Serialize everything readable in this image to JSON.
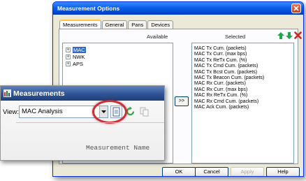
{
  "dialog": {
    "title": "Measurement Options",
    "tabs": [
      "Measurements",
      "General",
      "Pans",
      "Devices"
    ],
    "available_header": "Available",
    "selected_header": "Selected",
    "tree": [
      {
        "label": "MAC",
        "expander": "+",
        "selected": true
      },
      {
        "label": "NWK",
        "expander": "+",
        "selected": false
      },
      {
        "label": "APS",
        "expander": "+",
        "selected": false
      }
    ],
    "selected_items": [
      "MAC Tx Cum. (packets)",
      "MAC Tx Curr. (max bps)",
      "MAC Tx ReTx Cum. (%)",
      "MAC Tx Cmd Cum. (packets)",
      "MAC Tx Bcst Cum. (packets)",
      "MAC Tx Beacon Cum. (packets)",
      "MAC Rx Curr. (packets)",
      "MAC Rx Curr. (max bps)",
      "MAC Rx ReTx Cum. (%)",
      "MAC Rx Cmd Cum. (packets)",
      "MAC Ack Cum. (packets)"
    ],
    "move_button": ">>",
    "buttons": {
      "ok": "OK",
      "cancel": "Cancel",
      "apply": "Apply",
      "help": "Help"
    },
    "apply_enabled": false,
    "icons": {
      "up": "up-arrow-icon",
      "down": "down-arrow-icon",
      "delete": "red-x-delete-icon",
      "close": "close-icon"
    },
    "colors": {
      "title_bar": "#0a5fe8",
      "up_down_arrows": "#1aa84a",
      "delete": "#d8211d",
      "tree_selection": "#316ac5"
    }
  },
  "inset": {
    "title": "Measurements",
    "view_label": "View:",
    "view_value": "MAC Analysis",
    "column_header": "Measurement Name",
    "icons": {
      "app": "measurements-app-icon",
      "dropdown": "chevron-down-icon",
      "new": "new-document-icon",
      "refresh": "refresh-icon",
      "copy": "copy-icon"
    },
    "highlight_color": "#c7323a"
  }
}
